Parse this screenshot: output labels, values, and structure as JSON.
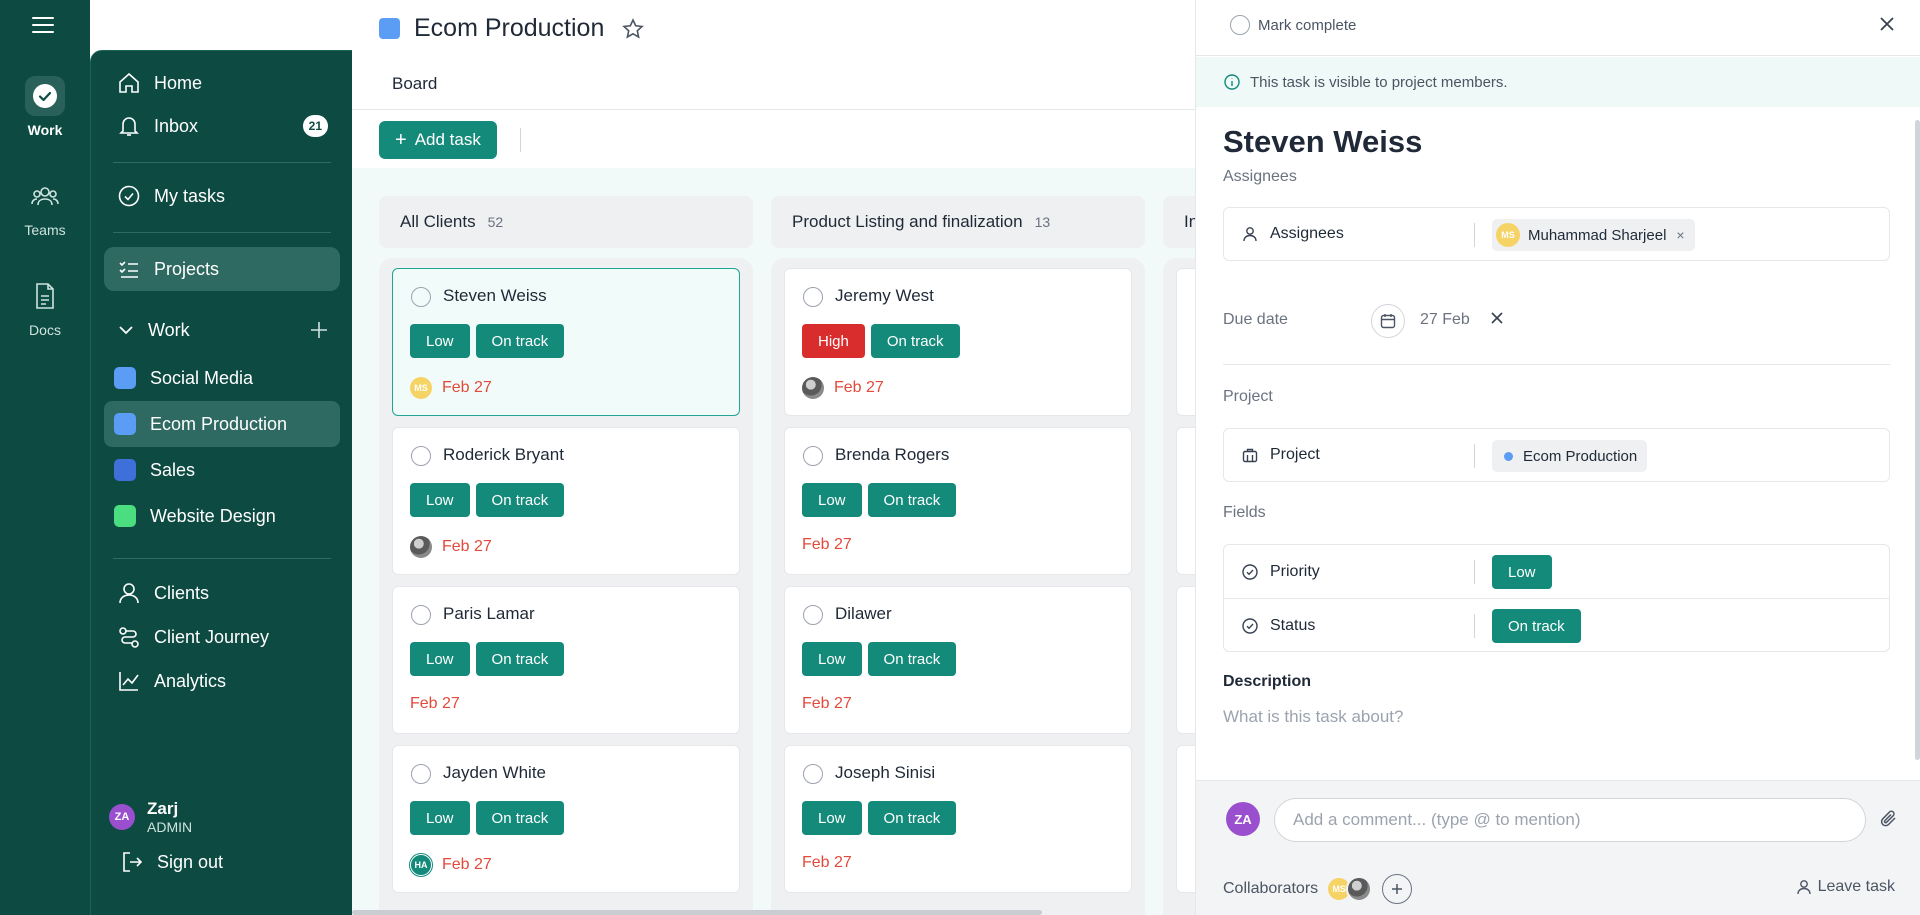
{
  "rail": {
    "items": [
      {
        "label": "Work",
        "icon": "check-circle-icon"
      },
      {
        "label": "Teams",
        "icon": "people-icon"
      },
      {
        "label": "Docs",
        "icon": "document-icon"
      }
    ]
  },
  "sidebar": {
    "nav": [
      {
        "label": "Home",
        "icon": "home-icon"
      },
      {
        "label": "Inbox",
        "icon": "bell-icon",
        "badge": "21"
      },
      {
        "label": "My tasks",
        "icon": "check-circle-icon"
      },
      {
        "label": "Projects",
        "icon": "list-check-icon"
      }
    ],
    "work_label": "Work",
    "projects": [
      {
        "label": "Social Media",
        "color": "#5b9cf5"
      },
      {
        "label": "Ecom Production",
        "color": "#5b9cf5"
      },
      {
        "label": "Sales",
        "color": "#3f6fd8"
      },
      {
        "label": "Website Design",
        "color": "#4ade80"
      }
    ],
    "secondary": [
      {
        "label": "Clients",
        "icon": "user-icon"
      },
      {
        "label": "Client Journey",
        "icon": "route-icon"
      },
      {
        "label": "Analytics",
        "icon": "chart-line-icon"
      }
    ],
    "user": {
      "initials": "ZA",
      "name": "Zarj",
      "role": "ADMIN"
    },
    "signout": "Sign out"
  },
  "header": {
    "project_title": "Ecom Production",
    "tab": "Board",
    "add_task": "Add task"
  },
  "board": {
    "columns": [
      {
        "title": "All Clients",
        "count": "52",
        "cards": [
          {
            "name": "Steven Weiss",
            "priority": "Low",
            "status": "On track",
            "due": "Feb 27",
            "avatar": "MS"
          },
          {
            "name": "Roderick Bryant",
            "priority": "Low",
            "status": "On track",
            "due": "Feb 27",
            "avatar": "photo"
          },
          {
            "name": "Paris Lamar",
            "priority": "Low",
            "status": "On track",
            "due": "Feb 27",
            "avatar": ""
          },
          {
            "name": "Jayden White",
            "priority": "Low",
            "status": "On track",
            "due": "Feb 27",
            "avatar": "HA"
          }
        ]
      },
      {
        "title": "Product Listing and finalization",
        "count": "13",
        "cards": [
          {
            "name": "Jeremy West",
            "priority": "High",
            "status": "On track",
            "due": "Feb 27",
            "avatar": "photo"
          },
          {
            "name": "Brenda Rogers",
            "priority": "Low",
            "status": "On track",
            "due": "Feb 27",
            "avatar": ""
          },
          {
            "name": "Dilawer",
            "priority": "Low",
            "status": "On track",
            "due": "Feb 27",
            "avatar": ""
          },
          {
            "name": "Joseph Sinisi",
            "priority": "Low",
            "status": "On track",
            "due": "Feb 27",
            "avatar": ""
          }
        ]
      },
      {
        "title": "In",
        "count": "",
        "cards": []
      }
    ]
  },
  "panel": {
    "mark_complete": "Mark complete",
    "notice": "This task is visible to project members.",
    "title": "Steven Weiss",
    "subtitle": "Assignees",
    "assignees_label": "Assignees",
    "assignee": {
      "initials": "MS",
      "name": "Muhammad Sharjeel"
    },
    "due_label": "Due date",
    "due_value": "27 Feb",
    "project_section": "Project",
    "project_label": "Project",
    "project_value": "Ecom Production",
    "fields_section": "Fields",
    "fields": [
      {
        "label": "Priority",
        "value": "Low"
      },
      {
        "label": "Status",
        "value": "On track"
      }
    ],
    "description_label": "Description",
    "description_placeholder": "What is this task about?",
    "comment": {
      "initials": "ZA",
      "placeholder": "Add a comment... (type @ to mention)"
    },
    "collaborators_label": "Collaborators",
    "collaborators": [
      "MS",
      "photo"
    ],
    "leave_task": "Leave task"
  },
  "colors": {
    "sidebar_bg": "#0c4a42",
    "accent": "#138a7a",
    "high": "#d92d2d",
    "due": "#e24a3b"
  }
}
